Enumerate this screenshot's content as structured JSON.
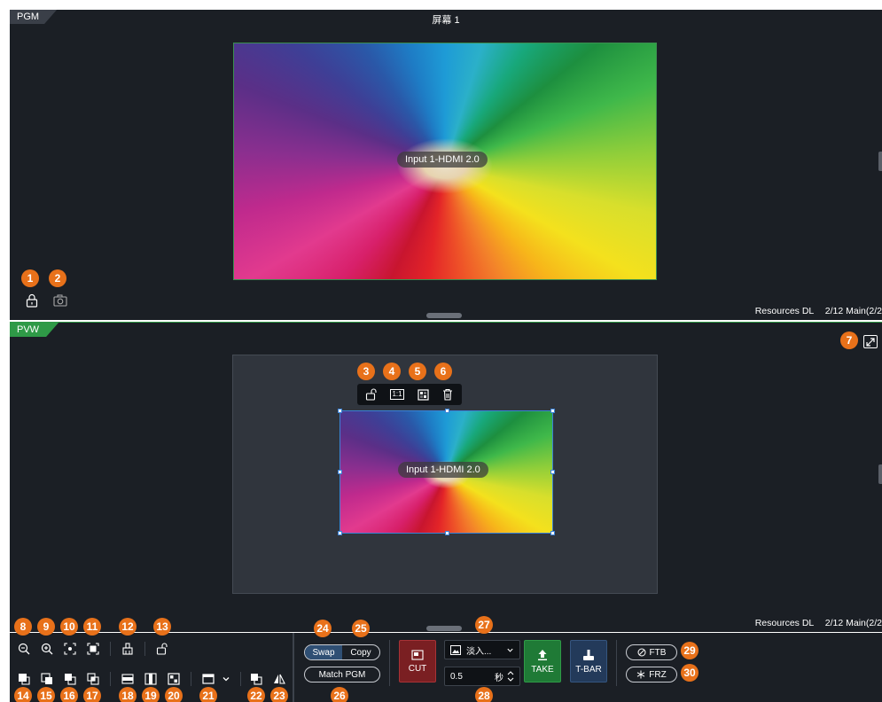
{
  "pgm": {
    "tag": "PGM",
    "screen_title": "屏幕 1",
    "input_label": "Input 1-HDMI 2.0",
    "resources": "Resources DL",
    "layer_count": "2/12 Main(2/2"
  },
  "pvw": {
    "tag": "PVW",
    "input_label": "Input 1-HDMI 2.0",
    "resources": "Resources DL",
    "layer_count": "2/12 Main(2/2"
  },
  "layer_toolbar": {
    "ratio_label": "1:1"
  },
  "switching": {
    "swap_label": "Swap",
    "copy_label": "Copy",
    "match_pgm_label": "Match PGM",
    "cut_label": "CUT",
    "effect_value": "淡入...",
    "duration_value": "0.5",
    "duration_unit": "秒",
    "take_label": "TAKE",
    "tbar_label": "T-BAR",
    "ftb_label": "FTB",
    "frz_label": "FRZ"
  },
  "badges": [
    "1",
    "2",
    "3",
    "4",
    "5",
    "6",
    "7",
    "8",
    "9",
    "10",
    "11",
    "12",
    "13",
    "14",
    "15",
    "16",
    "17",
    "18",
    "19",
    "20",
    "21",
    "22",
    "23",
    "24",
    "25",
    "26",
    "27",
    "28",
    "29",
    "30"
  ],
  "colors": {
    "panel_bg": "#1b1f25",
    "pvw_accent": "#2f9a47",
    "cut_red": "#7a1f22",
    "take_green": "#1f7a36",
    "tbar_blue": "#233a5a",
    "badge_orange": "#e8711a",
    "selection_blue": "#3b82d6"
  }
}
